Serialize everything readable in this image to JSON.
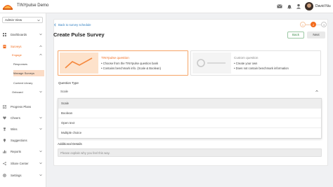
{
  "app": {
    "title": "TINYpulse Demo",
    "user_name": "David Niu"
  },
  "topbar_icons": [
    "mail-icon",
    "bell-icon",
    "user-icon"
  ],
  "sidebar": {
    "view_select": "Admin View",
    "items": [
      {
        "label": "Dashboards"
      },
      {
        "label": "Surveys"
      },
      {
        "label": "Engage"
      },
      {
        "label": "Responses"
      },
      {
        "label": "Manage Surveys"
      },
      {
        "label": "Content Library"
      },
      {
        "label": "Onboard"
      },
      {
        "label": "Progress Plans"
      },
      {
        "label": "Cheers"
      },
      {
        "label": "Wins"
      },
      {
        "label": "Suggestions"
      },
      {
        "label": "Reports"
      },
      {
        "label": "Share Center"
      },
      {
        "label": "Settings"
      }
    ]
  },
  "stepper": {
    "steps": [
      "1",
      "2",
      "3"
    ],
    "current": 2
  },
  "main": {
    "back_link": "Back to survey schedule",
    "title": "Create Pulse Survey",
    "back_button": "Back",
    "next_button": "Next",
    "cards": [
      {
        "title": "TINYpulse question",
        "lines": [
          "• Choose from the TINYpulse question bank",
          "• Contains benchmark info. (Scale & Boolean)"
        ]
      },
      {
        "title": "Custom question",
        "lines": [
          "• Create your own",
          "• Does not contain benchmark information"
        ]
      }
    ],
    "question_type_label": "Question Type",
    "question_type_value": "Scale",
    "question_type_options": [
      "Scale",
      "Boolean",
      "Open text",
      "Multiple choice"
    ],
    "additional_details_label": "Additional Details",
    "additional_details_placeholder": "Please explain why you feel this way."
  },
  "colors": {
    "accent": "#f26b1d",
    "link": "#2f7ec0",
    "success": "#3c8f4a"
  }
}
